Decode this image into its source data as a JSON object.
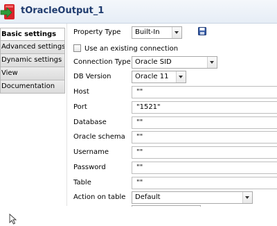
{
  "component": {
    "title": "tOracleOutput_1",
    "icon": "oracle-output-component-icon"
  },
  "sidebar": {
    "items": [
      {
        "label": "Basic settings",
        "active": true
      },
      {
        "label": "Advanced settings",
        "active": false
      },
      {
        "label": "Dynamic settings",
        "active": false
      },
      {
        "label": "View",
        "active": false
      },
      {
        "label": "Documentation",
        "active": false
      }
    ]
  },
  "form": {
    "property_type": {
      "label": "Property Type",
      "value": "Built-In"
    },
    "save_icon": "floppy-disk-icon",
    "existing_connection": {
      "label": "Use an existing connection",
      "checked": false
    },
    "connection_type": {
      "label": "Connection Type",
      "value": "Oracle SID"
    },
    "db_version": {
      "label": "DB Version",
      "value": "Oracle 11"
    },
    "host": {
      "label": "Host",
      "value": "\"\""
    },
    "port": {
      "label": "Port",
      "value": "\"1521\""
    },
    "database": {
      "label": "Database",
      "value": "\"\""
    },
    "oracle_schema": {
      "label": "Oracle schema",
      "value": "\"\""
    },
    "username": {
      "label": "Username",
      "value": "\"\""
    },
    "password": {
      "label": "Password",
      "value": "\"\""
    },
    "table": {
      "label": "Table",
      "value": "\"\""
    },
    "action_on_table": {
      "label": "Action on table",
      "value": "Default"
    }
  },
  "colors": {
    "title_text": "#1f3b6e",
    "titlebar_bg": "#e6edf6",
    "active_tab_bg": "#ffffff",
    "inactive_tab_bg": "#dcdcdc",
    "field_border": "#bdbdbd"
  }
}
